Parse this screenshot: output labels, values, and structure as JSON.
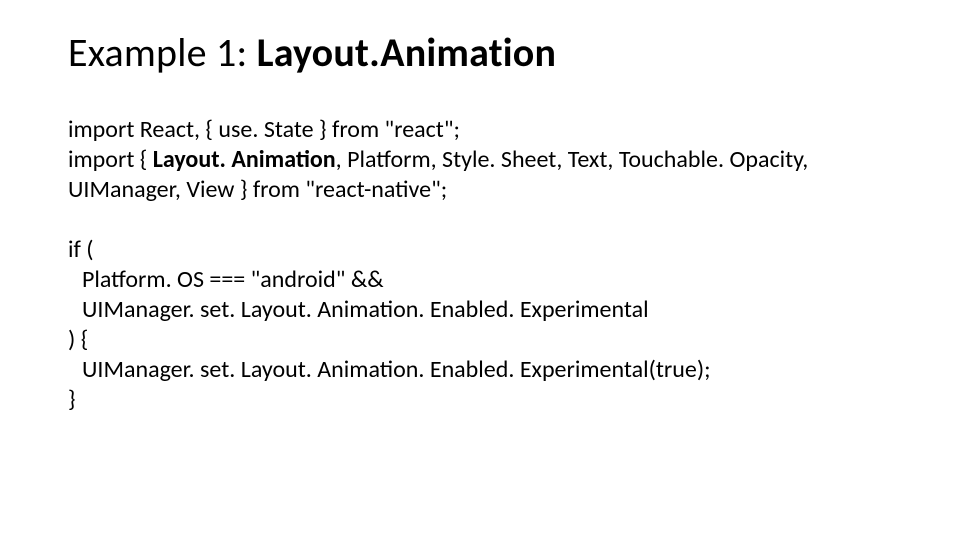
{
  "title": {
    "prefix": "Example 1: ",
    "bold": "Layout.Animation"
  },
  "code": {
    "l1a": "import React, { use. State } from \"react\";",
    "l2a": "import { ",
    "l2b": "Layout. Animation",
    "l2c": ", Platform, Style. Sheet, Text, Touchable. Opacity, UIManager, View } from \"react-native\";",
    "l3": "if (",
    "l4": "Platform. OS === \"android\" &&",
    "l5": "UIManager. set. Layout. Animation. Enabled. Experimental",
    "l6": ") {",
    "l7": "UIManager. set. Layout. Animation. Enabled. Experimental(true);",
    "l8": "}"
  }
}
